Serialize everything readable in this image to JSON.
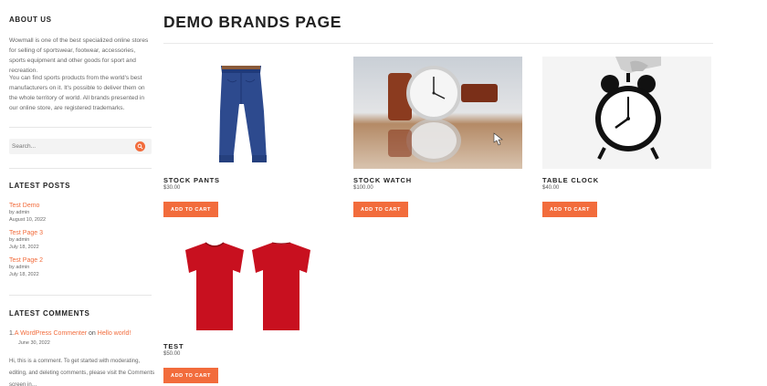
{
  "sidebar": {
    "about": {
      "title": "ABOUT US",
      "p1": "Wowmall is one of the best specialized online stores for selling of sportswear, footwear, accessories, sports equipment and other goods for sport and recreation.",
      "p2": "You can find sports products from the world's best manufacturers on it. It's possible to deliver them on the whole territory of world. All brands presented in our online store, are registered trademarks."
    },
    "search": {
      "placeholder": "Search...",
      "icon": "search-icon"
    },
    "latest_posts": {
      "title": "LATEST POSTS",
      "items": [
        {
          "label": "Test Demo",
          "by": "by admin",
          "date": "August 10, 2022"
        },
        {
          "label": "Test Page 3",
          "by": "by admin",
          "date": "July 18, 2022"
        },
        {
          "label": "Test Page 2",
          "by": "by admin",
          "date": "July 18, 2022"
        }
      ]
    },
    "latest_comments": {
      "title": "LATEST COMMENTS",
      "number": "1.",
      "author": "A WordPress Commenter",
      "on": "on",
      "post": "Hello world!",
      "date": "June 30, 2022",
      "excerpt": "Hi, this is a comment. To get started with moderating, editing, and deleting comments, please visit the Comments screen in…"
    }
  },
  "main": {
    "title": "DEMO BRANDS PAGE",
    "products": [
      {
        "name": "STOCK PANTS",
        "price": "$30.00",
        "button": "ADD TO CART",
        "image": "blue-pants-image"
      },
      {
        "name": "STOCK WATCH",
        "price": "$100.00",
        "button": "ADD TO CART",
        "image": "wrist-watch-image"
      },
      {
        "name": "TABLE CLOCK",
        "price": "$40.00",
        "button": "ADD TO CART",
        "image": "alarm-clock-image"
      },
      {
        "name": "TEST",
        "price": "$50.00",
        "button": "ADD TO CART",
        "image": "red-tshirt-image"
      }
    ]
  },
  "colors": {
    "accent": "#f26c3c",
    "heading": "#222222",
    "text": "#555555"
  }
}
